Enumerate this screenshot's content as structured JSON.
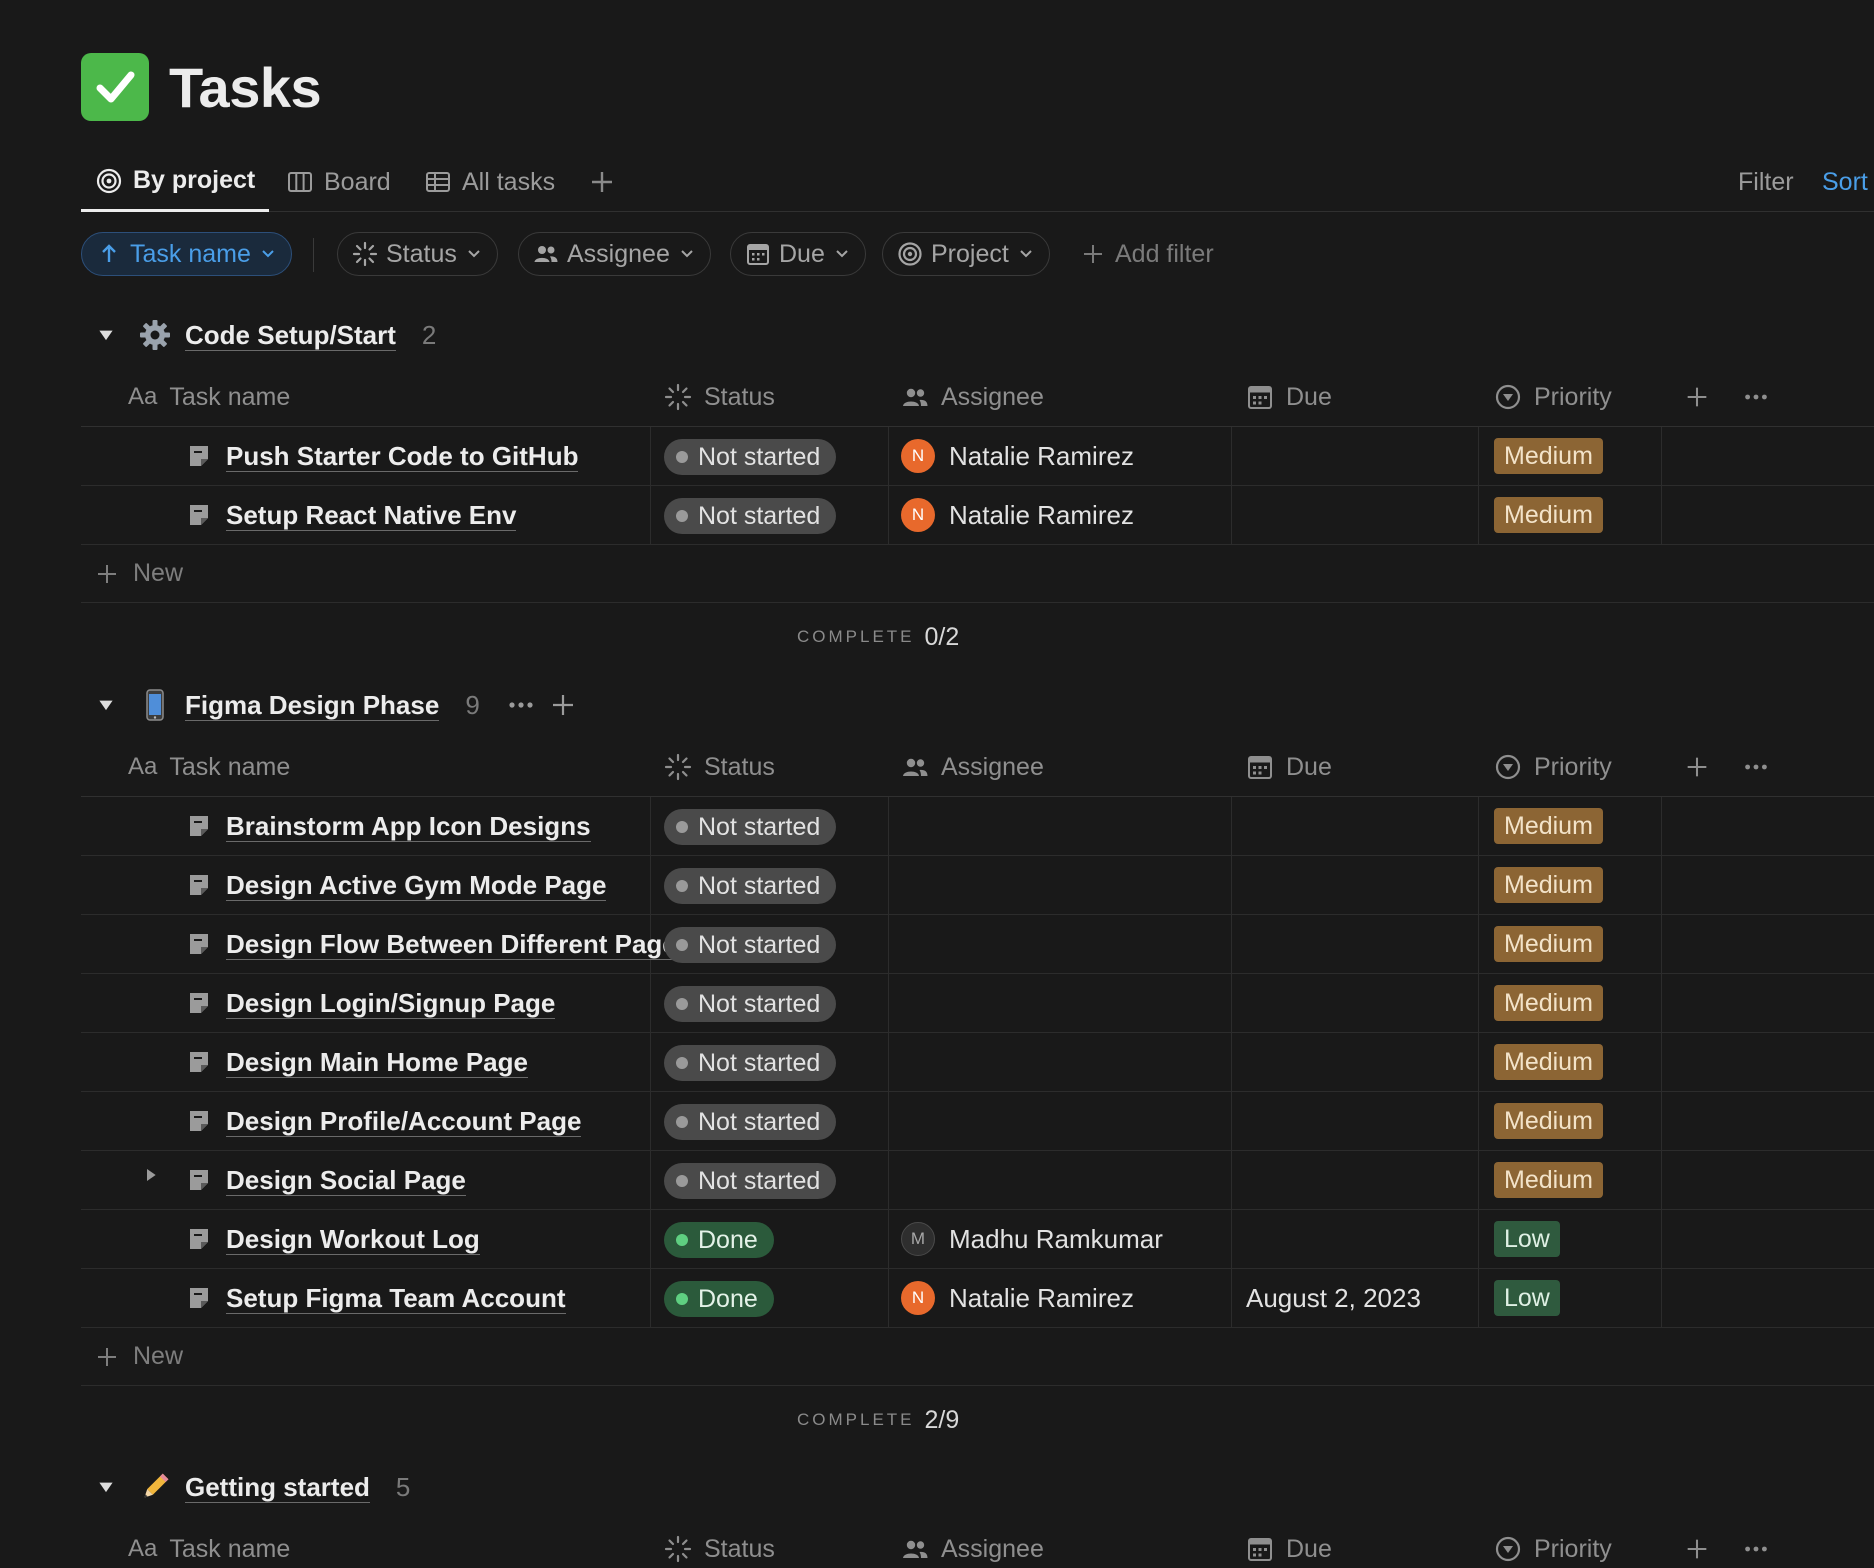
{
  "page": {
    "title": "Tasks"
  },
  "views": {
    "tabs": [
      {
        "label": "By project",
        "icon": "target-icon",
        "active": true
      },
      {
        "label": "Board",
        "icon": "board-icon",
        "active": false
      },
      {
        "label": "All tasks",
        "icon": "table-icon",
        "active": false
      }
    ],
    "filter_label": "Filter",
    "sort_label": "Sort"
  },
  "filters": {
    "sort_chip": "Task name",
    "status": "Status",
    "assignee": "Assignee",
    "due": "Due",
    "project": "Project",
    "add_filter": "Add filter"
  },
  "columns": {
    "aa": "Aa",
    "task_name": "Task name",
    "status": "Status",
    "assignee": "Assignee",
    "due": "Due",
    "priority": "Priority"
  },
  "new_label": "New",
  "complete_label": "COMPLETE",
  "colors": {
    "background": "#191919",
    "accent_blue": "#4a9ee8",
    "medium": "#8c6534",
    "low": "#2f5a3e",
    "done": "#2b5a3b",
    "not_started": "#4a4a4a",
    "avatar_orange": "#e8692c"
  },
  "groups": [
    {
      "name": "Code Setup/Start",
      "emoji": "gear-icon",
      "count": "2",
      "complete": "0/2",
      "tasks": [
        {
          "name": "Push Starter Code to GitHub",
          "status": "Not started",
          "assignee": "Natalie Ramirez",
          "avatar": "N",
          "due": "",
          "priority": "Medium"
        },
        {
          "name": "Setup React Native Env",
          "status": "Not started",
          "assignee": "Natalie Ramirez",
          "avatar": "N",
          "due": "",
          "priority": "Medium"
        }
      ]
    },
    {
      "name": "Figma Design Phase",
      "emoji": "phone-icon",
      "count": "9",
      "complete": "2/9",
      "tasks": [
        {
          "name": "Brainstorm App Icon Designs",
          "status": "Not started",
          "assignee": "",
          "avatar": "",
          "due": "",
          "priority": "Medium"
        },
        {
          "name": "Design Active Gym Mode Page",
          "status": "Not started",
          "assignee": "",
          "avatar": "",
          "due": "",
          "priority": "Medium"
        },
        {
          "name": "Design Flow Between Different Pages",
          "status": "Not started",
          "assignee": "",
          "avatar": "",
          "due": "",
          "priority": "Medium"
        },
        {
          "name": "Design Login/Signup Page",
          "status": "Not started",
          "assignee": "",
          "avatar": "",
          "due": "",
          "priority": "Medium"
        },
        {
          "name": "Design Main Home Page",
          "status": "Not started",
          "assignee": "",
          "avatar": "",
          "due": "",
          "priority": "Medium"
        },
        {
          "name": "Design Profile/Account Page",
          "status": "Not started",
          "assignee": "",
          "avatar": "",
          "due": "",
          "priority": "Medium"
        },
        {
          "name": "Design Social Page",
          "status": "Not started",
          "assignee": "",
          "avatar": "",
          "due": "",
          "priority": "Medium"
        },
        {
          "name": "Design Workout Log",
          "status": "Done",
          "assignee": "Madhu Ramkumar",
          "avatar": "M",
          "due": "",
          "priority": "Low"
        },
        {
          "name": "Setup Figma Team Account",
          "status": "Done",
          "assignee": "Natalie Ramirez",
          "avatar": "N",
          "due": "August 2, 2023",
          "priority": "Low"
        }
      ]
    },
    {
      "name": "Getting started",
      "emoji": "pencil-icon",
      "count": "5",
      "complete": "",
      "tasks": []
    }
  ]
}
